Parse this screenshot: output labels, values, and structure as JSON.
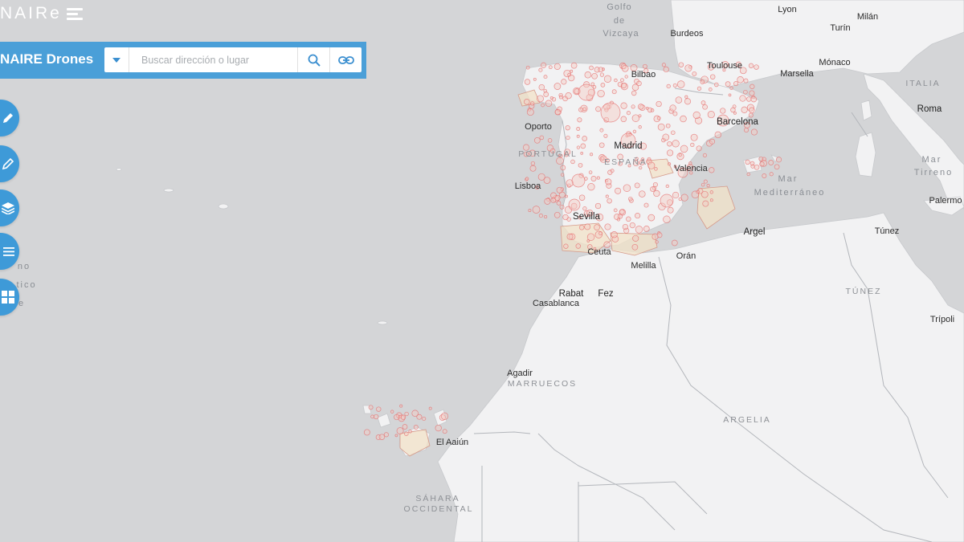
{
  "app": {
    "brand": "NAIRe",
    "title": "NAIRE Drones"
  },
  "search": {
    "placeholder": "Buscar dirección o lugar"
  },
  "tools": [
    {
      "name": "draw-tool",
      "icon": "pencil-icon"
    },
    {
      "name": "measure-tool",
      "icon": "ruler-icon"
    },
    {
      "name": "layers-tool",
      "icon": "layers-icon"
    },
    {
      "name": "legend-tool",
      "icon": "list-icon"
    },
    {
      "name": "basemap-tool",
      "icon": "grid-icon"
    }
  ],
  "map": {
    "labels": {
      "golfo_1": "Golfo",
      "golfo_2": "de",
      "golfo_3": "Vizcaya",
      "lyon": "Lyon",
      "milan": "Milán",
      "burdeos": "Burdeos",
      "turin": "Turín",
      "toulouse": "Toulouse",
      "monaco": "Mónaco",
      "bilbao": "Bilbao",
      "marsella": "Marsella",
      "italia": "ITALIA",
      "roma": "Roma",
      "oporto": "Oporto",
      "barcelona": "Barcelona",
      "portugal": "PORTUGAL",
      "madrid": "Madrid",
      "espana": "ESPAÑA",
      "valencia": "Valencia",
      "mar_tirreno_1": "Mar",
      "mar_tirreno_2": "Tirreno",
      "mar_med_1": "Mar",
      "mar_med_2": "Mediterráneo",
      "lisboa": "Lisboa",
      "palermo": "Palermo",
      "sevilla": "Sevilla",
      "argel": "Argel",
      "tunez_city": "Túnez",
      "ceuta": "Ceuta",
      "oran": "Orán",
      "melilla": "Melilla",
      "tunez_country": "TÚNEZ",
      "rabat": "Rabat",
      "fez": "Fez",
      "casablanca": "Casablanca",
      "tripoli": "Trípoli",
      "agadir": "Agadir",
      "marruecos": "MARRUECOS",
      "argelia": "ARGELIA",
      "el_aaiun": "El Aaiún",
      "sahara_1": "SÁHARA",
      "sahara_2": "OCCIDENTAL",
      "atlantic_1": "no",
      "atlantic_2": "tico",
      "atlantic_3": "e"
    },
    "colors": {
      "ocean": "#d4d5d7",
      "land": "#f2f2f3",
      "border": "#b3b6bb",
      "zone_stroke": "#e46b6b",
      "zone_fill": "#f4c9c4",
      "tma_fill": "#f1e1c8",
      "accent": "#4a9fd8"
    }
  }
}
